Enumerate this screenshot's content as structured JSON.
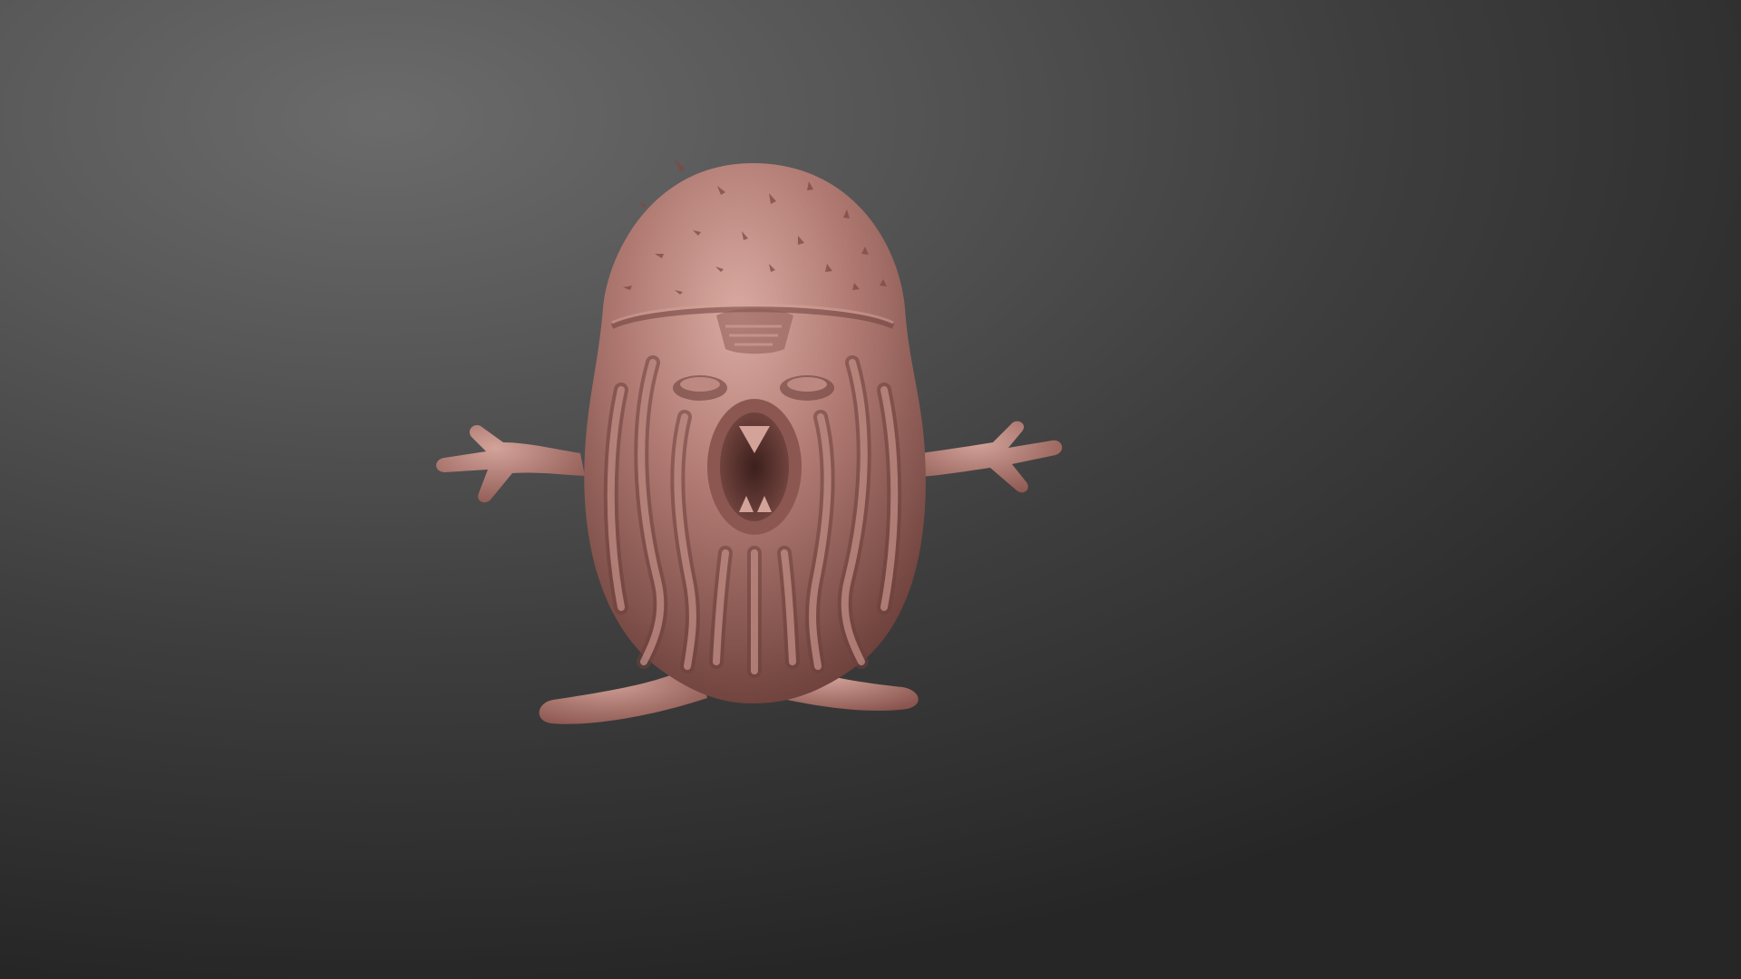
{
  "viewport": {
    "background_color_light": "#6b6b6b",
    "background_color_dark": "#262626"
  },
  "model": {
    "material_color": "#b07a72",
    "material_shadow": "#6d403b",
    "material_highlight": "#d3a39a"
  }
}
